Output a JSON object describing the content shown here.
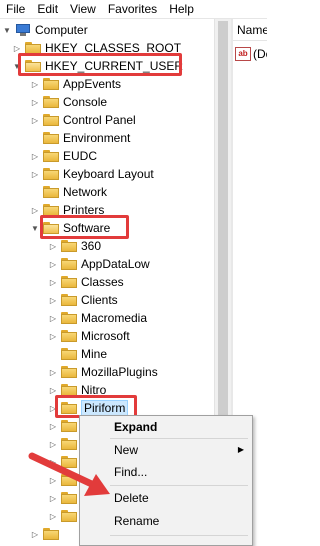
{
  "menubar": {
    "items": [
      "File",
      "Edit",
      "View",
      "Favorites",
      "Help"
    ]
  },
  "tree": {
    "root_label": "Computer",
    "hives": {
      "classes_root": "HKEY_CLASSES_ROOT",
      "current_user": "HKEY_CURRENT_USER"
    },
    "hkcu_children": [
      "AppEvents",
      "Console",
      "Control Panel",
      "Environment",
      "EUDC",
      "Keyboard Layout",
      "Network",
      "Printers",
      "Software"
    ],
    "software_children": [
      "360",
      "AppDataLow",
      "Classes",
      "Clients",
      "Macromedia",
      "Microsoft",
      "Mine",
      "MozillaPlugins",
      "Nitro",
      "Piriform"
    ]
  },
  "right_pane": {
    "column_header": "Name",
    "value_icon": "ab",
    "value_name": "(De"
  },
  "context_menu": {
    "items": [
      {
        "label": "Expand",
        "bold": true
      },
      {
        "label": "New",
        "has_submenu": true
      },
      {
        "label": "Find..."
      },
      {
        "label": "Delete"
      },
      {
        "label": "Rename"
      }
    ]
  },
  "colors": {
    "highlight_red": "#e23b3b",
    "selection_bg": "#cce8ff",
    "folder_yellow": "#f0c04e"
  }
}
